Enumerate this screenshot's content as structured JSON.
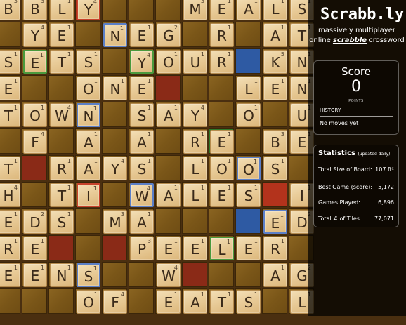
{
  "board_rows": [
    [
      [
        "B",
        3
      ],
      [
        "B",
        3
      ],
      [
        "L",
        1
      ],
      [
        "Y",
        4
      ],
      null,
      null,
      null,
      [
        "M",
        3
      ],
      [
        "E",
        1
      ],
      [
        "A",
        1
      ],
      [
        "L",
        1
      ],
      [
        "S",
        1
      ]
    ],
    [
      null,
      [
        "Y",
        4
      ],
      [
        "E",
        1
      ],
      null,
      [
        "N",
        1
      ],
      [
        "E",
        1
      ],
      [
        "G",
        2
      ],
      null,
      [
        "R",
        1
      ],
      null,
      [
        "A",
        1
      ],
      [
        "T",
        1
      ]
    ],
    [
      [
        "S",
        1
      ],
      [
        "E",
        1
      ],
      [
        "T",
        1
      ],
      [
        "S",
        1
      ],
      null,
      [
        "Y",
        4
      ],
      [
        "O",
        1
      ],
      [
        "U",
        1
      ],
      [
        "R",
        1
      ],
      null,
      [
        "K",
        5
      ],
      [
        "N",
        1
      ]
    ],
    [
      [
        "E",
        1
      ],
      null,
      null,
      [
        "O",
        1
      ],
      [
        "N",
        1
      ],
      [
        "E",
        1
      ],
      null,
      null,
      null,
      [
        "L",
        1
      ],
      [
        "E",
        1
      ],
      [
        "N",
        1
      ]
    ],
    [
      [
        "T",
        1
      ],
      [
        "O",
        1
      ],
      [
        "W",
        4
      ],
      [
        "N",
        1
      ],
      null,
      [
        "S",
        1
      ],
      [
        "A",
        1
      ],
      [
        "Y",
        4
      ],
      null,
      [
        "O",
        1
      ],
      null,
      [
        "U",
        1
      ]
    ],
    [
      null,
      [
        "F",
        4
      ],
      null,
      [
        "A",
        1
      ],
      null,
      [
        "A",
        1
      ],
      null,
      [
        "R",
        1
      ],
      [
        "E",
        1
      ],
      null,
      [
        "B",
        3
      ],
      [
        "E",
        1
      ]
    ],
    [
      [
        "T",
        1
      ],
      null,
      [
        "R",
        1
      ],
      [
        "A",
        1
      ],
      [
        "Y",
        4
      ],
      [
        "S",
        1
      ],
      null,
      [
        "L",
        1
      ],
      [
        "O",
        1
      ],
      [
        "O",
        1
      ],
      [
        "S",
        1
      ],
      null
    ],
    [
      [
        "H",
        4
      ],
      null,
      [
        "T",
        1
      ],
      [
        "I",
        1
      ],
      null,
      [
        "W",
        4
      ],
      [
        "A",
        1
      ],
      [
        "L",
        1
      ],
      [
        "E",
        1
      ],
      [
        "S",
        1
      ],
      null,
      [
        "I",
        1
      ]
    ],
    [
      [
        "E",
        1
      ],
      [
        "D",
        2
      ],
      [
        "S",
        1
      ],
      null,
      [
        "M",
        3
      ],
      [
        "A",
        1
      ],
      null,
      null,
      null,
      null,
      [
        "E",
        1
      ],
      [
        "D",
        2
      ]
    ],
    [
      [
        "R",
        1
      ],
      [
        "E",
        1
      ],
      null,
      null,
      null,
      [
        "P",
        3
      ],
      [
        "E",
        1
      ],
      [
        "E",
        1
      ],
      [
        "L",
        1
      ],
      [
        "E",
        1
      ],
      [
        "R",
        1
      ],
      null
    ],
    [
      [
        "E",
        1
      ],
      [
        "E",
        1
      ],
      [
        "N",
        1
      ],
      [
        "S",
        1
      ],
      null,
      null,
      [
        "W",
        4
      ],
      null,
      null,
      null,
      [
        "A",
        1
      ],
      [
        "G",
        2
      ]
    ],
    [
      null,
      null,
      null,
      [
        "O",
        1
      ],
      [
        "F",
        4
      ],
      null,
      [
        "E",
        1
      ],
      [
        "A",
        1
      ],
      [
        "T",
        1
      ],
      [
        "S",
        1
      ],
      null,
      [
        "L",
        1
      ]
    ]
  ],
  "board_colors": [
    [
      null,
      null,
      null,
      "brightred",
      null,
      null,
      null,
      null,
      null,
      null,
      null,
      null
    ],
    [
      null,
      null,
      null,
      null,
      null,
      null,
      null,
      null,
      null,
      null,
      null,
      null
    ],
    [
      null,
      null,
      null,
      null,
      null,
      null,
      null,
      null,
      null,
      "blue",
      null,
      null
    ],
    [
      null,
      null,
      null,
      null,
      null,
      null,
      "red",
      null,
      null,
      null,
      null,
      null
    ],
    [
      null,
      null,
      null,
      null,
      null,
      null,
      null,
      null,
      null,
      null,
      null,
      null
    ],
    [
      null,
      null,
      null,
      null,
      null,
      null,
      null,
      null,
      "green",
      null,
      null,
      null
    ],
    [
      null,
      "red",
      null,
      null,
      null,
      null,
      null,
      null,
      null,
      null,
      null,
      null
    ],
    [
      null,
      null,
      null,
      null,
      null,
      null,
      null,
      null,
      null,
      null,
      "brightred",
      null
    ],
    [
      null,
      null,
      null,
      null,
      null,
      null,
      null,
      null,
      null,
      "blue",
      null,
      null
    ],
    [
      null,
      null,
      "red",
      null,
      "red",
      null,
      null,
      null,
      null,
      null,
      null,
      null
    ],
    [
      null,
      null,
      null,
      null,
      null,
      null,
      null,
      "red",
      null,
      null,
      null,
      null
    ],
    [
      null,
      null,
      null,
      null,
      null,
      null,
      null,
      null,
      null,
      null,
      null,
      null
    ]
  ],
  "board_outlines": [
    [
      null,
      null,
      null,
      "or",
      null,
      null,
      null,
      null,
      null,
      null,
      null,
      null
    ],
    [
      null,
      null,
      null,
      null,
      "ob",
      null,
      null,
      null,
      null,
      null,
      null,
      null
    ],
    [
      null,
      "og",
      null,
      null,
      null,
      "og",
      null,
      null,
      null,
      null,
      null,
      null
    ],
    [
      null,
      null,
      null,
      null,
      null,
      null,
      null,
      null,
      null,
      null,
      null,
      null
    ],
    [
      null,
      null,
      null,
      "ob",
      null,
      null,
      null,
      null,
      null,
      null,
      null,
      null
    ],
    [
      null,
      null,
      null,
      null,
      null,
      null,
      null,
      null,
      null,
      null,
      null,
      null
    ],
    [
      null,
      null,
      null,
      null,
      null,
      null,
      null,
      null,
      null,
      "ob",
      null,
      null
    ],
    [
      null,
      null,
      null,
      "or",
      null,
      "ob",
      null,
      null,
      null,
      null,
      null,
      null
    ],
    [
      null,
      null,
      null,
      null,
      null,
      null,
      null,
      null,
      null,
      null,
      "ob",
      null
    ],
    [
      null,
      null,
      null,
      null,
      null,
      null,
      null,
      null,
      "og",
      null,
      null,
      null
    ],
    [
      null,
      null,
      null,
      "ob",
      null,
      null,
      null,
      null,
      null,
      null,
      null,
      null
    ],
    [
      null,
      null,
      null,
      null,
      null,
      null,
      null,
      null,
      null,
      null,
      null,
      null
    ]
  ],
  "logo": "Scrabb.ly",
  "tagline_line1": "massively multiplayer",
  "tagline_line2_prefix": "online ",
  "tagline_line2_em": "scrabble",
  "tagline_line2_suffix": " crossword",
  "score": {
    "title": "Score",
    "value": "0",
    "unit": "POINTS",
    "history_title": "HISTORY",
    "history_empty": "No moves yet"
  },
  "stats": {
    "title": "Statistics",
    "subtitle": "(updated daily)",
    "rows": [
      {
        "key": "Total Size of Board:",
        "value": "107 ft²"
      },
      {
        "key": "Best Game (score):",
        "value": "5,172"
      },
      {
        "key": "Games Played:",
        "value": "6,896"
      },
      {
        "key": "Total # of Tiles:",
        "value": "77,071"
      }
    ]
  }
}
